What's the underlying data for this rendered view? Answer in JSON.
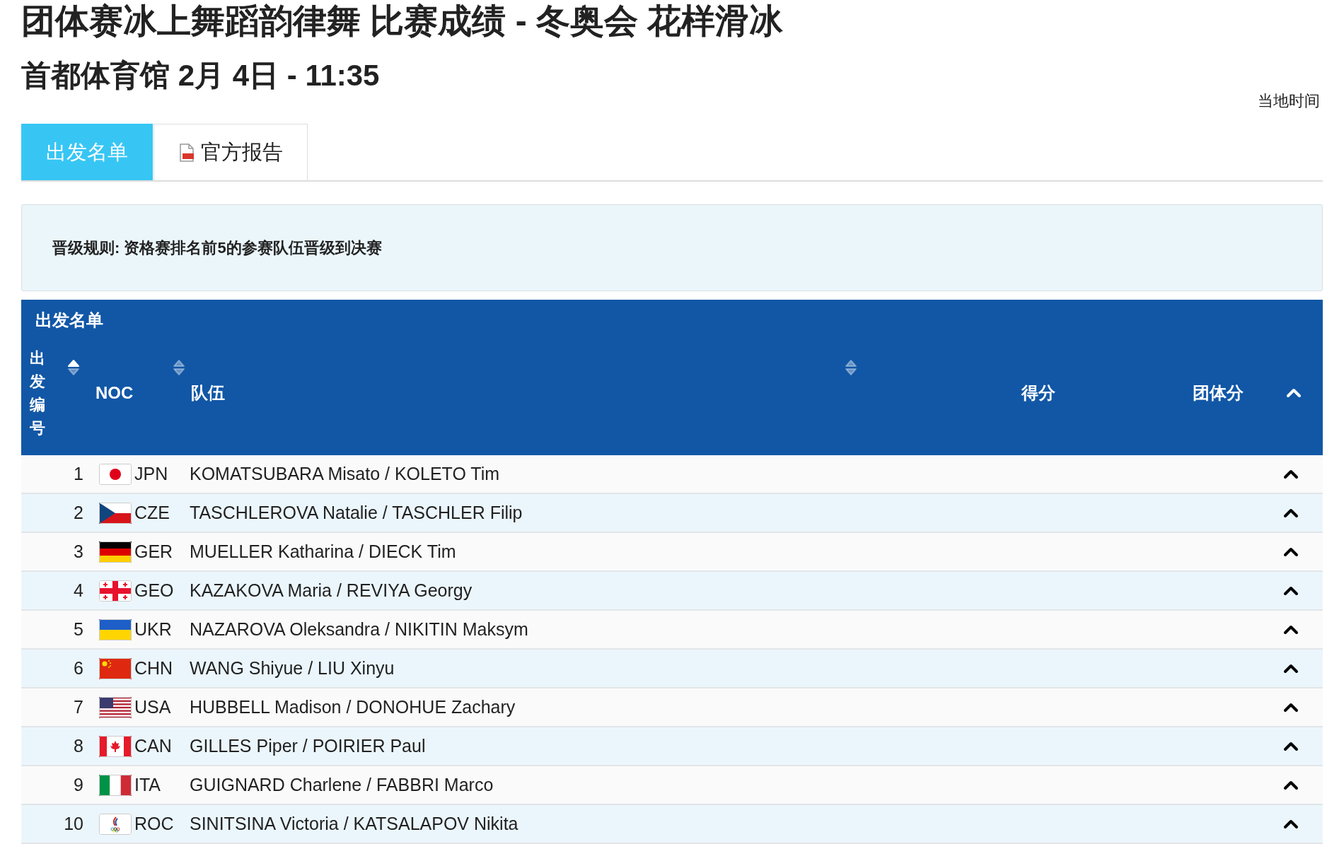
{
  "title": "团体赛冰上舞蹈韵律舞 比赛成绩 - 冬奥会 花样滑冰",
  "subtitle": "首都体育馆 2月 4日 - 11:35",
  "time_note": "当地时间",
  "tabs": [
    {
      "label": "出发名单",
      "selected": true,
      "kind": "plain"
    },
    {
      "label": "官方报告",
      "selected": false,
      "kind": "pdf"
    }
  ],
  "rule_text": "晋级规则: 资格赛排名前5的参赛队伍晋级到决赛",
  "table": {
    "caption": "出发名单",
    "columns": [
      {
        "label": "出发编号",
        "sorted": true,
        "kind": "vertical"
      },
      {
        "label": "NOC",
        "sorted": false,
        "kind": "plain"
      },
      {
        "label": "队伍",
        "sorted": false,
        "kind": "plain"
      },
      {
        "label": "得分",
        "kind": "plain"
      },
      {
        "label": "团体分",
        "kind": "plain"
      }
    ],
    "rows": [
      {
        "order": "1",
        "kind": "japan",
        "noc": "JPN",
        "team": "KOMATSUBARA Misato / KOLETO Tim"
      },
      {
        "order": "2",
        "kind": "czechia",
        "noc": "CZE",
        "team": "TASCHLEROVA Natalie / TASCHLER Filip"
      },
      {
        "order": "3",
        "kind": "germany",
        "noc": "GER",
        "team": "MUELLER Katharina / DIECK Tim"
      },
      {
        "order": "4",
        "kind": "georgia",
        "noc": "GEO",
        "team": "KAZAKOVA Maria / REVIYA Georgy"
      },
      {
        "order": "5",
        "kind": "ukraine",
        "noc": "UKR",
        "team": "NAZAROVA Oleksandra / NIKITIN Maksym"
      },
      {
        "order": "6",
        "kind": "china",
        "noc": "CHN",
        "team": "WANG Shiyue / LIU Xinyu"
      },
      {
        "order": "7",
        "kind": "usa",
        "noc": "USA",
        "team": "HUBBELL Madison / DONOHUE Zachary"
      },
      {
        "order": "8",
        "kind": "canada",
        "noc": "CAN",
        "team": "GILLES Piper / POIRIER Paul"
      },
      {
        "order": "9",
        "kind": "italy",
        "noc": "ITA",
        "team": "GUIGNARD Charlene / FABBRI Marco"
      },
      {
        "order": "10",
        "kind": "olympic",
        "noc": "ROC",
        "team": "SINITSINA Victoria / KATSALAPOV Nikita"
      }
    ]
  }
}
